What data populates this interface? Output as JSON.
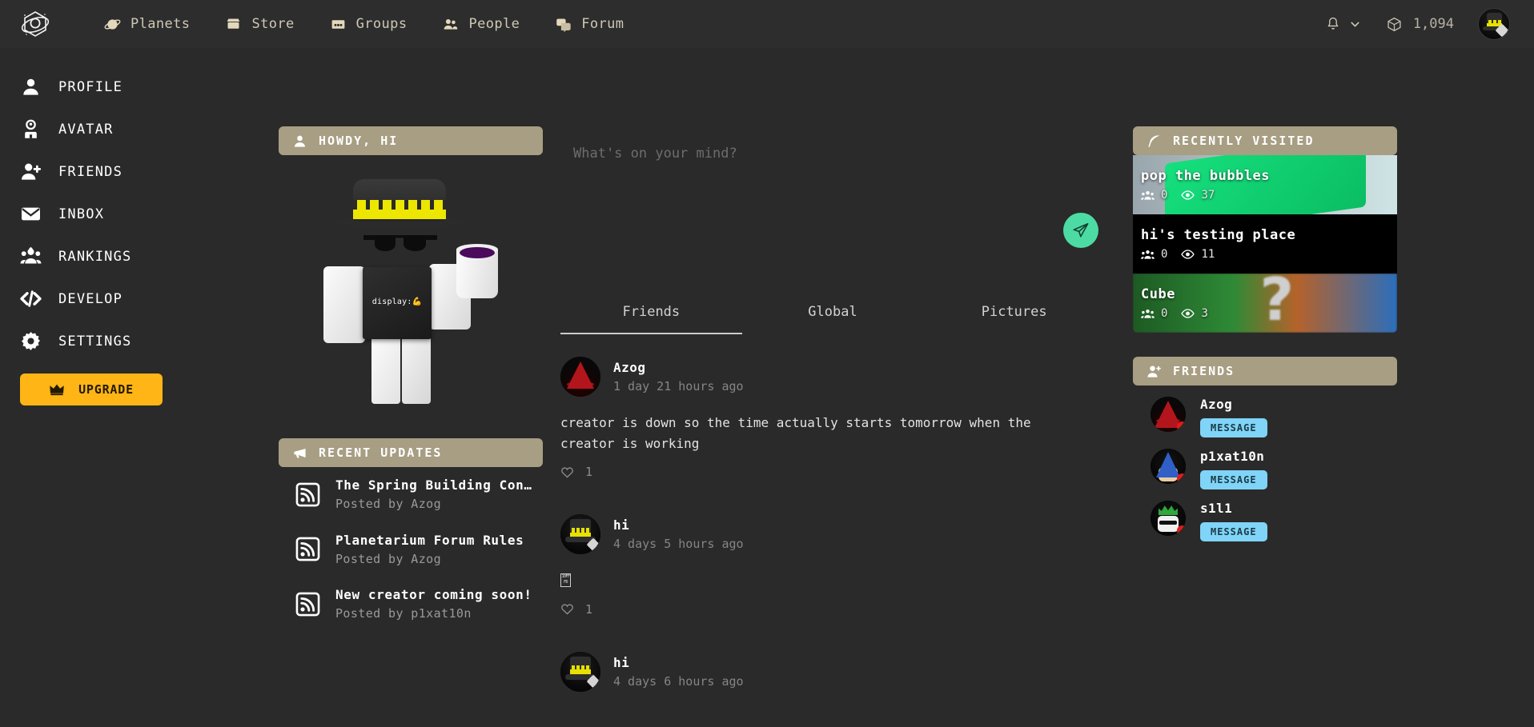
{
  "topnav": {
    "logo_icon": "planetarium-logo",
    "links": [
      {
        "label": "Planets",
        "icon": "planet-icon"
      },
      {
        "label": "Store",
        "icon": "store-icon"
      },
      {
        "label": "Groups",
        "icon": "groups-icon"
      },
      {
        "label": "People",
        "icon": "people-icon"
      },
      {
        "label": "Forum",
        "icon": "forum-icon"
      }
    ],
    "notifications_icon": "bell-icon",
    "notifications_chevron_icon": "chevron-down-icon",
    "currency_icon": "cube-icon",
    "currency_amount": "1,094",
    "avatar_icon": "user-avatar"
  },
  "sidebar": {
    "items": [
      {
        "label": "PROFILE",
        "icon": "person-icon"
      },
      {
        "label": "AVATAR",
        "icon": "avatar-icon"
      },
      {
        "label": "FRIENDS",
        "icon": "person-add-icon"
      },
      {
        "label": "INBOX",
        "icon": "envelope-icon"
      },
      {
        "label": "RANKINGS",
        "icon": "people-group-icon"
      },
      {
        "label": "DEVELOP",
        "icon": "code-icon"
      },
      {
        "label": "SETTINGS",
        "icon": "gear-icon"
      }
    ],
    "upgrade_label": "UPGRADE",
    "upgrade_icon": "crown-icon"
  },
  "profile_card": {
    "header": "HOWDY, HI",
    "header_icon": "person-icon",
    "avatar_shirt_text": "display:",
    "avatar_shirt_emoji": "💪"
  },
  "recent_updates": {
    "header": "RECENT UPDATES",
    "header_icon": "megaphone-icon",
    "items": [
      {
        "title": "The Spring Building Con…",
        "subtitle": "Posted by Azog",
        "icon": "rss-icon"
      },
      {
        "title": "Planetarium Forum Rules",
        "subtitle": "Posted by Azog",
        "icon": "rss-icon"
      },
      {
        "title": "New creator coming soon!",
        "subtitle": "Posted by p1xat10n",
        "icon": "rss-icon"
      }
    ]
  },
  "feed": {
    "composer": {
      "placeholder": "What's on your mind?",
      "value": "",
      "send_icon": "paper-plane-icon",
      "send_color": "#4ddba4"
    },
    "tabs": [
      {
        "label": "Friends",
        "active": true
      },
      {
        "label": "Global",
        "active": false
      },
      {
        "label": "Pictures",
        "active": false
      }
    ],
    "posts": [
      {
        "author": "Azog",
        "time": "1 day 21 hours ago",
        "body": "creator is down so the time actually starts tomorrow when the creator is working",
        "like_icon": "heart-icon",
        "likes": "1",
        "avatar": "wizard-hat-avatar"
      },
      {
        "author": "hi",
        "time": "4 days 5 hours ago",
        "body": "\u0010FFFD",
        "like_icon": "heart-icon",
        "likes": "1",
        "avatar": "top-hat-avatar"
      },
      {
        "author": "hi",
        "time": "4 days 6 hours ago",
        "body": "",
        "like_icon": "heart-icon",
        "likes": "",
        "avatar": "top-hat-avatar"
      }
    ]
  },
  "recently_visited": {
    "header": "RECENTLY VISITED",
    "header_icon": "feather-icon",
    "items": [
      {
        "title": "pop the bubbles",
        "players": "0",
        "visits": "37",
        "players_icon": "players-icon",
        "visits_icon": "eye-icon"
      },
      {
        "title": "hi's testing place",
        "players": "0",
        "visits": "11",
        "players_icon": "players-icon",
        "visits_icon": "eye-icon"
      },
      {
        "title": "Cube",
        "players": "0",
        "visits": "3",
        "players_icon": "players-icon",
        "visits_icon": "eye-icon"
      }
    ]
  },
  "friends_panel": {
    "header": "FRIENDS",
    "header_icon": "person-add-icon",
    "items": [
      {
        "name": "Azog",
        "message_label": "MESSAGE",
        "status": "offline",
        "status_color": "#e01b1b",
        "avatar": "wizard-hat-avatar"
      },
      {
        "name": "p1xat10n",
        "message_label": "MESSAGE",
        "status": "offline",
        "status_color": "#e01b1b",
        "avatar": "blue-wizard-avatar"
      },
      {
        "name": "s1l1",
        "message_label": "MESSAGE",
        "status": "offline",
        "status_color": "#e01b1b",
        "avatar": "green-crown-avatar"
      }
    ]
  },
  "theme": {
    "background": "#2a2a2a",
    "panel_header": "#a79e83",
    "accent_upgrade": "#ffb515",
    "accent_send": "#4ddba4",
    "accent_message": "#7fd4f7",
    "nav_text": "#cfc8b6"
  }
}
